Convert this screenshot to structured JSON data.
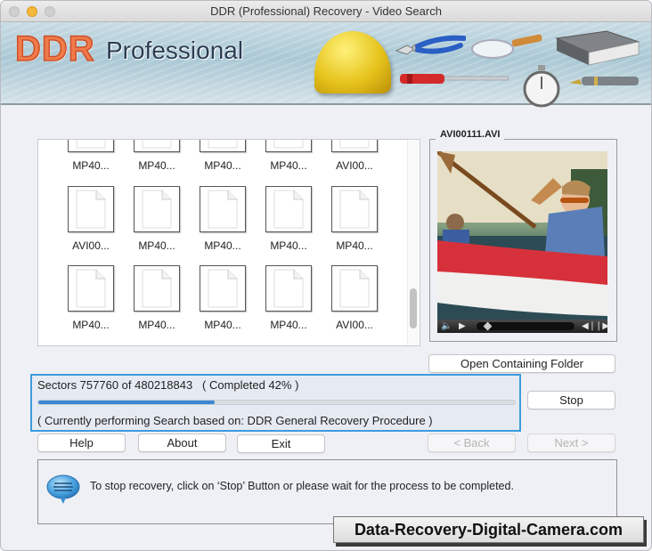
{
  "window": {
    "title": "DDR (Professional) Recovery - Video Search"
  },
  "banner": {
    "brand": "DDR",
    "product": "Professional",
    "icons": [
      "hard-hat-icon",
      "pliers-icon",
      "screwdriver-icon",
      "magnifier-icon",
      "stopwatch-icon",
      "book-icon",
      "fountain-pen-icon"
    ]
  },
  "files": {
    "rows": [
      [
        "MP40...",
        "MP40...",
        "MP40...",
        "MP40...",
        "AVI00..."
      ],
      [
        "AVI00...",
        "MP40...",
        "MP40...",
        "MP40...",
        "MP40..."
      ],
      [
        "MP40...",
        "MP40...",
        "MP40...",
        "MP40...",
        "AVI00..."
      ]
    ],
    "scroll_position": "bottom"
  },
  "preview": {
    "title": "AVI00111.AVI",
    "playback_position": 0.05,
    "controls": [
      "volume-icon",
      "play-icon",
      "step-back-icon",
      "step-forward-icon"
    ]
  },
  "buttons": {
    "open_folder": "Open Containing Folder",
    "stop": "Stop",
    "help": "Help",
    "about": "About",
    "exit": "Exit",
    "back": "< Back",
    "next": "Next >"
  },
  "progress": {
    "sectors_text": "Sectors 757760 of 480218843   ( Completed 42% )",
    "percent": 42,
    "procedure_text": "( Currently performing Search based on: DDR General Recovery Procedure )",
    "bar_fill_fraction": 0.37,
    "accent_color": "#3a87d6"
  },
  "message": {
    "text": "To stop recovery, click on ‘Stop’ Button or please wait for the process to be completed."
  },
  "watermark": {
    "text": "Data-Recovery-Digital-Camera.com"
  }
}
